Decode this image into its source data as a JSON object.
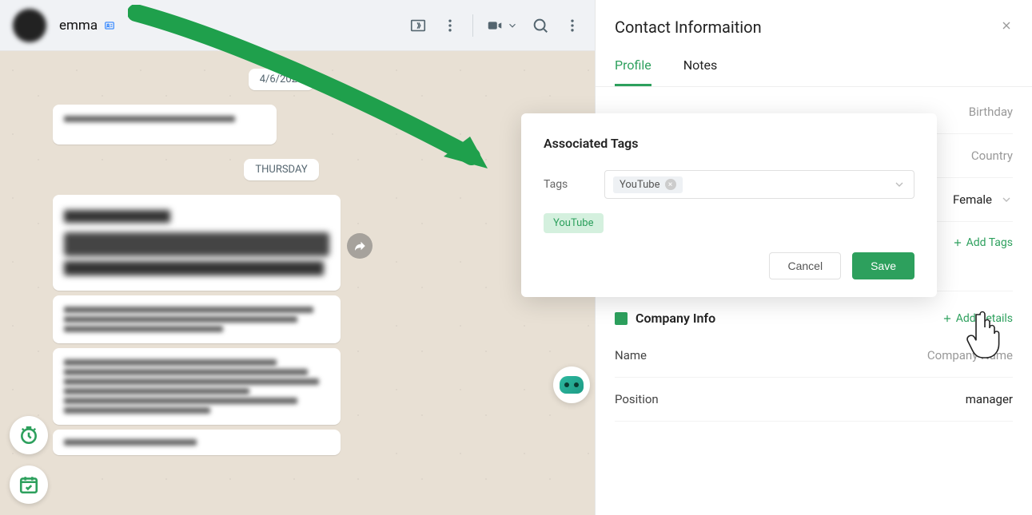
{
  "chat": {
    "contact_name": "emma",
    "dates": {
      "date1": "4/6/2024",
      "day1": "THURSDAY"
    }
  },
  "info_panel": {
    "title": "Contact Informaition",
    "tabs": {
      "profile": "Profile",
      "notes": "Notes"
    },
    "rows": {
      "birthday": {
        "label": "",
        "value": "Birthday"
      },
      "country": {
        "label": "",
        "value": "Country"
      },
      "gender": {
        "label": "",
        "value": "Female"
      }
    },
    "add_tags": "Add Tags",
    "tag1": "YouTube",
    "company": {
      "title": "Company Info",
      "add_details": "Add Details",
      "name_label": "Name",
      "name_placeholder": "Company Name",
      "position_label": "Position",
      "position_value": "manager"
    }
  },
  "modal": {
    "title": "Associated Tags",
    "tags_label": "Tags",
    "selected_tag": "YouTube",
    "chip": "YouTube",
    "cancel": "Cancel",
    "save": "Save"
  }
}
